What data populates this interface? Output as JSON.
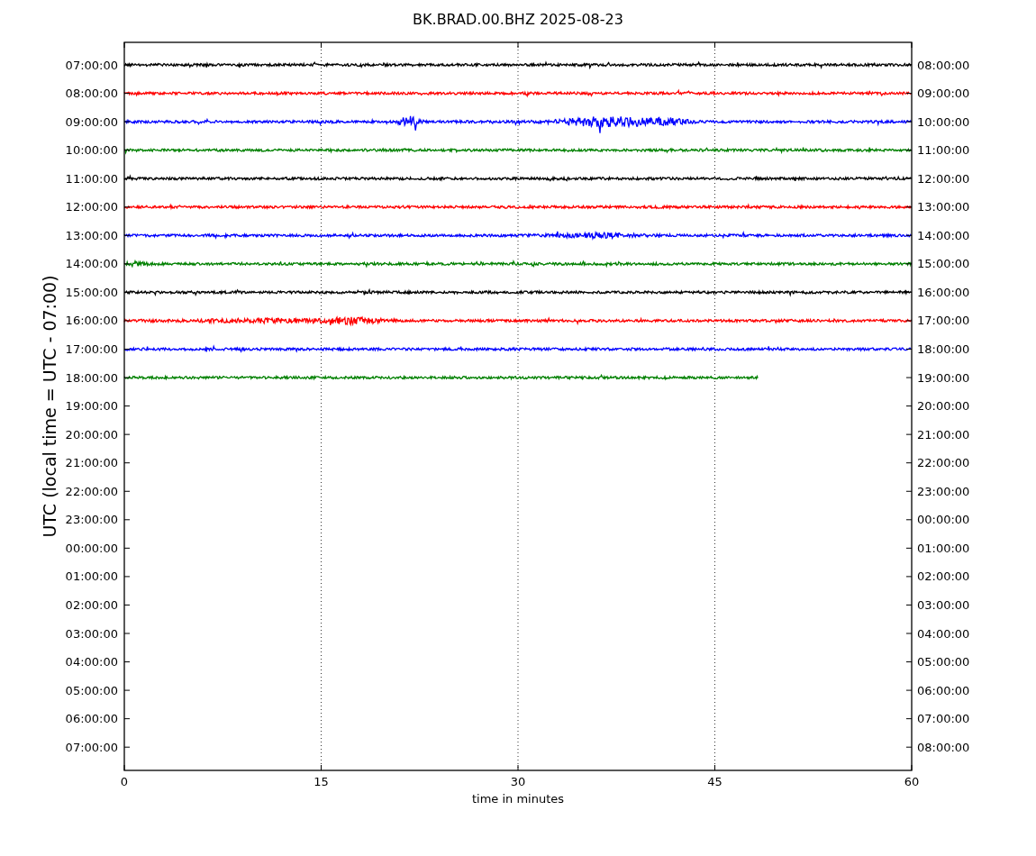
{
  "title": "BK.BRAD.00.BHZ 2025-08-23",
  "plot": {
    "ylabel": "UTC (local time = UTC - 07:00)",
    "xlabel": "time in minutes",
    "xticks": [
      "0",
      "15",
      "30",
      "45",
      "60"
    ],
    "left_labels": [
      "07:00:00",
      "08:00:00",
      "09:00:00",
      "10:00:00",
      "11:00:00",
      "12:00:00",
      "13:00:00",
      "14:00:00",
      "15:00:00",
      "16:00:00",
      "17:00:00",
      "18:00:00",
      "19:00:00",
      "20:00:00",
      "21:00:00",
      "22:00:00",
      "23:00:00",
      "00:00:00",
      "01:00:00",
      "02:00:00",
      "03:00:00",
      "04:00:00",
      "05:00:00",
      "06:00:00",
      "07:00:00"
    ],
    "right_labels": [
      "08:00:00",
      "09:00:00",
      "10:00:00",
      "11:00:00",
      "12:00:00",
      "13:00:00",
      "14:00:00",
      "15:00:00",
      "16:00:00",
      "17:00:00",
      "18:00:00",
      "19:00:00",
      "20:00:00",
      "21:00:00",
      "22:00:00",
      "23:00:00",
      "00:00:00",
      "01:00:00",
      "02:00:00",
      "03:00:00",
      "04:00:00",
      "05:00:00",
      "06:00:00",
      "07:00:00",
      "08:00:00"
    ],
    "traces": [
      {
        "color": "#000000",
        "level": 1
      },
      {
        "color": "#ff0000",
        "level": 1
      },
      {
        "color": "#0000ff",
        "level": 1
      },
      {
        "color": "#008000",
        "level": 1
      },
      {
        "color": "#000000",
        "level": 1
      },
      {
        "color": "#ff0000",
        "level": 1
      },
      {
        "color": "#0000ff",
        "level": 1
      },
      {
        "color": "#008000",
        "level": 1
      },
      {
        "color": "#000000",
        "level": 1
      },
      {
        "color": "#ff0000",
        "level": 1
      },
      {
        "color": "#0000ff",
        "level": 1
      },
      {
        "color": "#008000",
        "level": 0.805
      }
    ]
  }
}
